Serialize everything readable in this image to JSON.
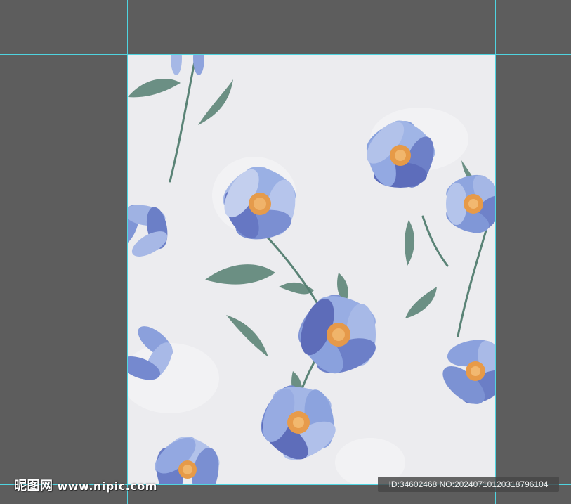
{
  "artwork": {
    "subject": "watercolor blue flowers seamless pattern",
    "background_color": "#ececef",
    "petal_colors": [
      "#9aaee0",
      "#7d93d3",
      "#5e6fbd",
      "#b9c7ea"
    ],
    "center_color": "#e79a4a",
    "leaf_color": "#4f7a6e"
  },
  "workspace": {
    "background_color": "#5d5d5d",
    "guide_color": "#4fd4e0"
  },
  "watermark": {
    "logo_text": "昵图网",
    "site_text": "www.nipic.com",
    "id_text": "ID:34602468 NO:20240710120318796104"
  }
}
